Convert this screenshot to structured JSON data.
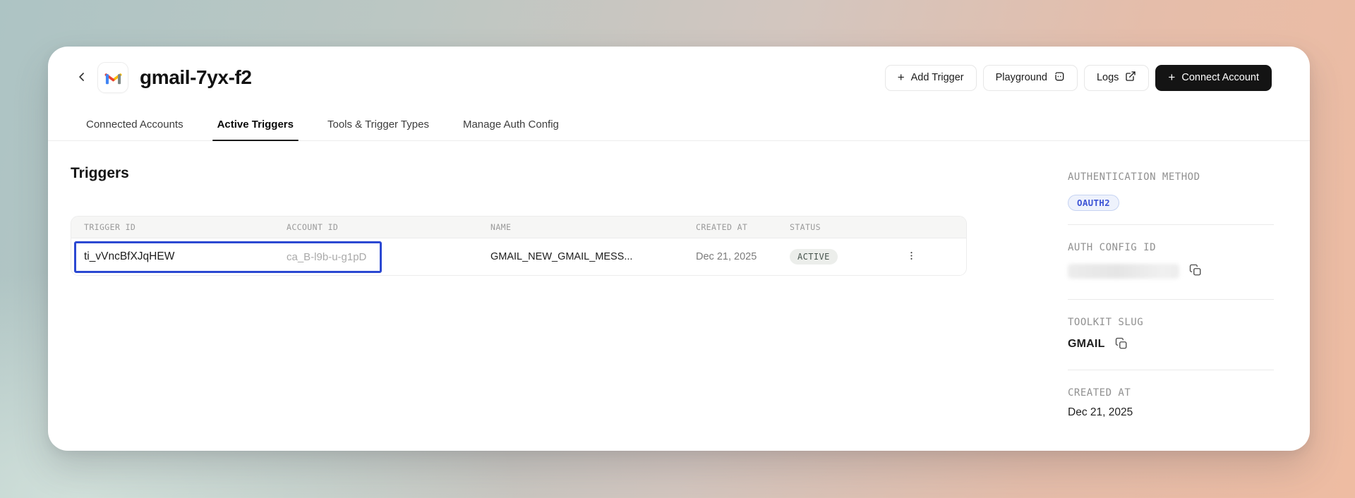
{
  "icons": {
    "plus": "+"
  },
  "header": {
    "title": "gmail-7yx-f2",
    "buttons": [
      {
        "label": "Add Trigger",
        "icon": "plus-icon",
        "variant": "secondary"
      },
      {
        "label": "Playground",
        "icon": "playground-icon",
        "variant": "secondary"
      },
      {
        "label": "Logs",
        "icon": "external-link-icon",
        "variant": "secondary"
      },
      {
        "label": "Connect Account",
        "icon": "plus-icon",
        "variant": "primary"
      }
    ]
  },
  "tabs": [
    {
      "label": "Connected Accounts",
      "active": false
    },
    {
      "label": "Active Triggers",
      "active": true
    },
    {
      "label": "Tools & Trigger Types",
      "active": false
    },
    {
      "label": "Manage Auth Config",
      "active": false
    }
  ],
  "main": {
    "heading": "Triggers",
    "table": {
      "columns": [
        "TRIGGER ID",
        "ACCOUNT ID",
        "NAME",
        "CREATED AT",
        "STATUS"
      ],
      "rows": [
        {
          "trigger_id": "ti_vVncBfXJqHEW",
          "account_id": "ca_B-l9b-u-g1pD",
          "name": "GMAIL_NEW_GMAIL_MESS...",
          "created_at": "Dec 21, 2025",
          "status": "ACTIVE",
          "selected": true
        }
      ]
    }
  },
  "sidebar": {
    "sections": [
      {
        "label": "AUTHENTICATION METHOD",
        "badge": "OAUTH2"
      },
      {
        "label": "AUTH CONFIG ID",
        "value_redacted": true
      },
      {
        "label": "TOOLKIT SLUG",
        "value": "GMAIL"
      },
      {
        "label": "CREATED AT",
        "value": "Dec 21, 2025"
      }
    ]
  },
  "colors": {
    "selection_blue": "#2b48d2",
    "oauth_badge_text": "#3e55d6",
    "oauth_badge_bg": "#eef2fc",
    "active_badge_bg": "#eceeeb",
    "active_badge_text": "#46534c",
    "primary_button_bg": "#141414"
  }
}
